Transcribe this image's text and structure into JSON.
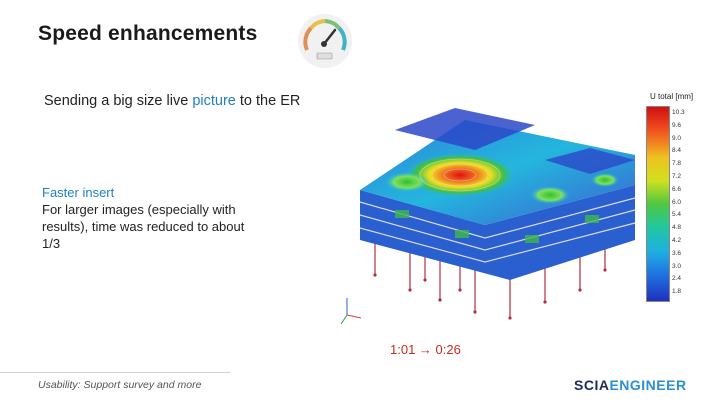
{
  "slide": {
    "title": "Speed enhancements",
    "subtitle_pre": "Sending a big size live ",
    "subtitle_highlight": "picture",
    "subtitle_post": " to the ER",
    "body": {
      "heading": "Faster insert",
      "lines": [
        "For larger images (especially with",
        "results), time was reduced to about",
        "1/3"
      ]
    },
    "time_text": "1:01 → 0:26",
    "footer": "Usability: Support survey and more",
    "logo": {
      "part1": "SCIA",
      "part2": "ENGINEER"
    }
  },
  "legend": {
    "title": "U total [mm]",
    "values": [
      "10.3",
      "9.6",
      "9.0",
      "8.4",
      "7.8",
      "7.2",
      "6.6",
      "6.0",
      "5.4",
      "4.8",
      "4.2",
      "3.6",
      "3.0",
      "2.4",
      "1.8"
    ]
  },
  "colors": {
    "accent_blue": "#1f7fc4",
    "time_red": "#cc2a1e",
    "logo_dark": "#1d2c59",
    "logo_light": "#2a8fd4"
  },
  "icons": {
    "gauge": "speedometer-icon"
  }
}
